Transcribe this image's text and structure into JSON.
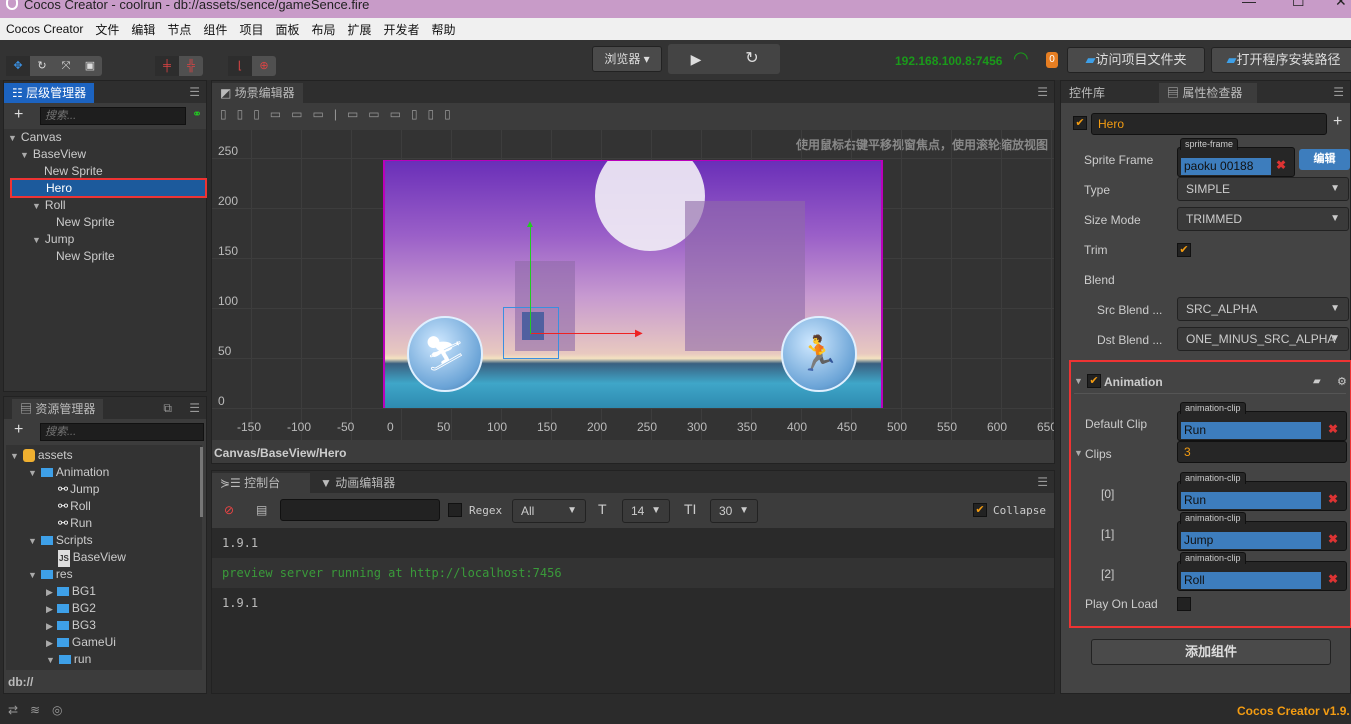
{
  "window": {
    "title": "Cocos Creator - coolrun - db://assets/sence/gameSence.fire"
  },
  "menu": [
    "Cocos Creator",
    "文件",
    "编辑",
    "节点",
    "组件",
    "项目",
    "面板",
    "布局",
    "扩展",
    "开发者",
    "帮助"
  ],
  "toolbar": {
    "platform": "浏览器",
    "ip": "192.168.100.8:7456",
    "badge": "0",
    "open_project_folder": "访问项目文件夹",
    "open_install_path": "打开程序安装路径",
    "accent": "#1a9a1a"
  },
  "hierarchy": {
    "title": "层级管理器",
    "search_placeholder": "搜索...",
    "items": [
      {
        "label": "Canvas",
        "depth": 0,
        "expanded": true
      },
      {
        "label": "BaseView",
        "depth": 1,
        "expanded": true
      },
      {
        "label": "New Sprite",
        "depth": 2
      },
      {
        "label": "Hero",
        "depth": 2,
        "selected": true
      },
      {
        "label": "Roll",
        "depth": 2,
        "expanded": true
      },
      {
        "label": "New Sprite",
        "depth": 3
      },
      {
        "label": "Jump",
        "depth": 2,
        "expanded": true
      },
      {
        "label": "New Sprite",
        "depth": 3
      }
    ]
  },
  "assets": {
    "title": "资源管理器",
    "search_placeholder": "搜索...",
    "path": "db://",
    "items": [
      {
        "label": "assets",
        "depth": 0,
        "type": "db",
        "expanded": true
      },
      {
        "label": "Animation",
        "depth": 1,
        "type": "folder",
        "expanded": true
      },
      {
        "label": "Jump",
        "depth": 2,
        "type": "anim"
      },
      {
        "label": "Roll",
        "depth": 2,
        "type": "anim"
      },
      {
        "label": "Run",
        "depth": 2,
        "type": "anim"
      },
      {
        "label": "Scripts",
        "depth": 1,
        "type": "folder",
        "expanded": true
      },
      {
        "label": "BaseView",
        "depth": 2,
        "type": "js"
      },
      {
        "label": "res",
        "depth": 1,
        "type": "folder",
        "expanded": true
      },
      {
        "label": "BG1",
        "depth": 2,
        "type": "folder",
        "expanded": false
      },
      {
        "label": "BG2",
        "depth": 2,
        "type": "folder",
        "expanded": false
      },
      {
        "label": "BG3",
        "depth": 2,
        "type": "folder",
        "expanded": false
      },
      {
        "label": "GameUi",
        "depth": 2,
        "type": "folder",
        "expanded": false
      },
      {
        "label": "run",
        "depth": 2,
        "type": "folder",
        "expanded": true
      }
    ]
  },
  "scene": {
    "title": "场景编辑器",
    "hint": "使用鼠标右键平移视窗焦点，使用滚轮缩放视图",
    "y_ticks": [
      "250",
      "200",
      "150",
      "100",
      "50",
      "0"
    ],
    "x_ticks": [
      "-150",
      "-100",
      "-50",
      "0",
      "50",
      "100",
      "150",
      "200",
      "250",
      "300",
      "350",
      "400",
      "450",
      "500",
      "550",
      "600",
      "650"
    ],
    "breadcrumb": "Canvas/BaseView/Hero"
  },
  "console": {
    "tab_console": "控制台",
    "tab_anim": "动画编辑器",
    "regex": "Regex",
    "level": "All",
    "font_size": "14",
    "line_height": "30",
    "collapse": "Collapse",
    "logs": [
      {
        "text": "1.9.1",
        "color": "#bbbbbb"
      },
      {
        "text": "preview server running at http://localhost:7456",
        "color": "#3a9a3a"
      },
      {
        "text": "1.9.1",
        "color": "#bbbbbb"
      }
    ]
  },
  "inspector": {
    "tab_widgets": "控件库",
    "tab_props": "属性检查器",
    "node_name": "Hero",
    "sprite": {
      "sprite_frame_label": "Sprite Frame",
      "sprite_frame_tag": "sprite-frame",
      "sprite_frame": "paoku 00188",
      "edit": "编辑",
      "type_label": "Type",
      "type": "SIMPLE",
      "size_mode_label": "Size Mode",
      "size_mode": "TRIMMED",
      "trim_label": "Trim",
      "trim": true,
      "blend_label": "Blend",
      "src_label": "Src Blend ...",
      "src": "SRC_ALPHA",
      "dst_label": "Dst Blend ...",
      "dst": "ONE_MINUS_SRC_ALPHA"
    },
    "animation": {
      "title": "Animation",
      "enabled": true,
      "default_clip_label": "Default Clip",
      "clip_tag": "animation-clip",
      "default_clip": "Run",
      "clips_label": "Clips",
      "clips_count": "3",
      "clips": [
        {
          "index": "[0]",
          "value": "Run"
        },
        {
          "index": "[1]",
          "value": "Jump"
        },
        {
          "index": "[2]",
          "value": "Roll"
        }
      ],
      "play_on_load_label": "Play On Load",
      "play_on_load": false
    },
    "add_component": "添加组件"
  },
  "status": {
    "version": "Cocos Creator v1.9."
  }
}
